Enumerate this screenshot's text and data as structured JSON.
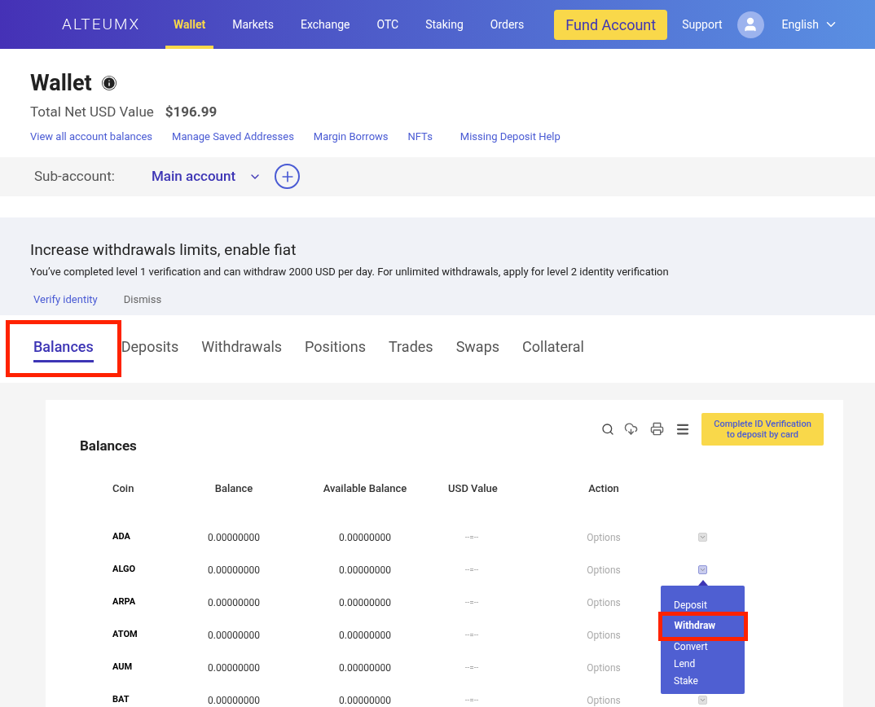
{
  "nav": {
    "logo": "ALTEUMX",
    "items": [
      {
        "label": "Wallet",
        "selected": true
      },
      {
        "label": "Markets",
        "selected": false
      },
      {
        "label": "Exchange",
        "selected": false
      },
      {
        "label": "OTC",
        "selected": false
      },
      {
        "label": "Staking",
        "selected": false
      },
      {
        "label": "Orders",
        "selected": false
      }
    ],
    "fund_button": "Fund Account",
    "support": "Support",
    "language": "English"
  },
  "header": {
    "title": "Wallet",
    "total_label": "Total Net USD Value",
    "total_value": "$196.99",
    "links": [
      "View all account balances",
      "Manage Saved Addresses",
      "Margin Borrows",
      "NFTs",
      "Missing Deposit Help"
    ]
  },
  "subaccount": {
    "label": "Sub-account:",
    "value": "Main account"
  },
  "banner": {
    "title": "Increase withdrawals limits, enable fiat",
    "text": "You’ve completed level 1 verification and can withdraw 2000 USD per day. For unlimited withdrawals, apply for level 2 identity verification",
    "actions": [
      {
        "label": "Verify identity",
        "kind": "link"
      },
      {
        "label": "Dismiss",
        "kind": "plain"
      }
    ]
  },
  "tabs": [
    {
      "label": "Balances",
      "selected": true,
      "highlighted": true
    },
    {
      "label": "Deposits",
      "selected": false,
      "highlighted": false
    },
    {
      "label": "Withdrawals",
      "selected": false,
      "highlighted": false
    },
    {
      "label": "Positions",
      "selected": false,
      "highlighted": false
    },
    {
      "label": "Trades",
      "selected": false,
      "highlighted": false
    },
    {
      "label": "Swaps",
      "selected": false,
      "highlighted": false
    },
    {
      "label": "Collateral",
      "selected": false,
      "highlighted": false
    }
  ],
  "card": {
    "title": "Balances",
    "verify_button": "Complete ID Verification to deposit by card",
    "columns": [
      "Coin",
      "Balance",
      "Available Balance",
      "USD Value",
      "Action"
    ],
    "rows": [
      {
        "coin": "ADA",
        "balance": "0.00000000",
        "available": "0.00000000",
        "usd": "--=--",
        "action": "Options",
        "expanded": false
      },
      {
        "coin": "ALGO",
        "balance": "0.00000000",
        "available": "0.00000000",
        "usd": "--=--",
        "action": "Options",
        "expanded": true
      },
      {
        "coin": "ARPA",
        "balance": "0.00000000",
        "available": "0.00000000",
        "usd": "--=--",
        "action": "Options",
        "expanded": false
      },
      {
        "coin": "ATOM",
        "balance": "0.00000000",
        "available": "0.00000000",
        "usd": "--=--",
        "action": "Options",
        "expanded": false
      },
      {
        "coin": "AUM",
        "balance": "0.00000000",
        "available": "0.00000000",
        "usd": "--=--",
        "action": "Options",
        "expanded": false
      },
      {
        "coin": "BAT",
        "balance": "0.00000000",
        "available": "0.00000000",
        "usd": "--=--",
        "action": "Options",
        "expanded": false
      }
    ],
    "menu": [
      {
        "label": "Deposit",
        "selected": false,
        "highlighted": false
      },
      {
        "label": "Withdraw",
        "selected": true,
        "highlighted": true
      },
      {
        "label": "Convert",
        "selected": false,
        "highlighted": false
      },
      {
        "label": "Lend",
        "selected": false,
        "highlighted": false
      },
      {
        "label": "Stake",
        "selected": false,
        "highlighted": false
      }
    ]
  }
}
